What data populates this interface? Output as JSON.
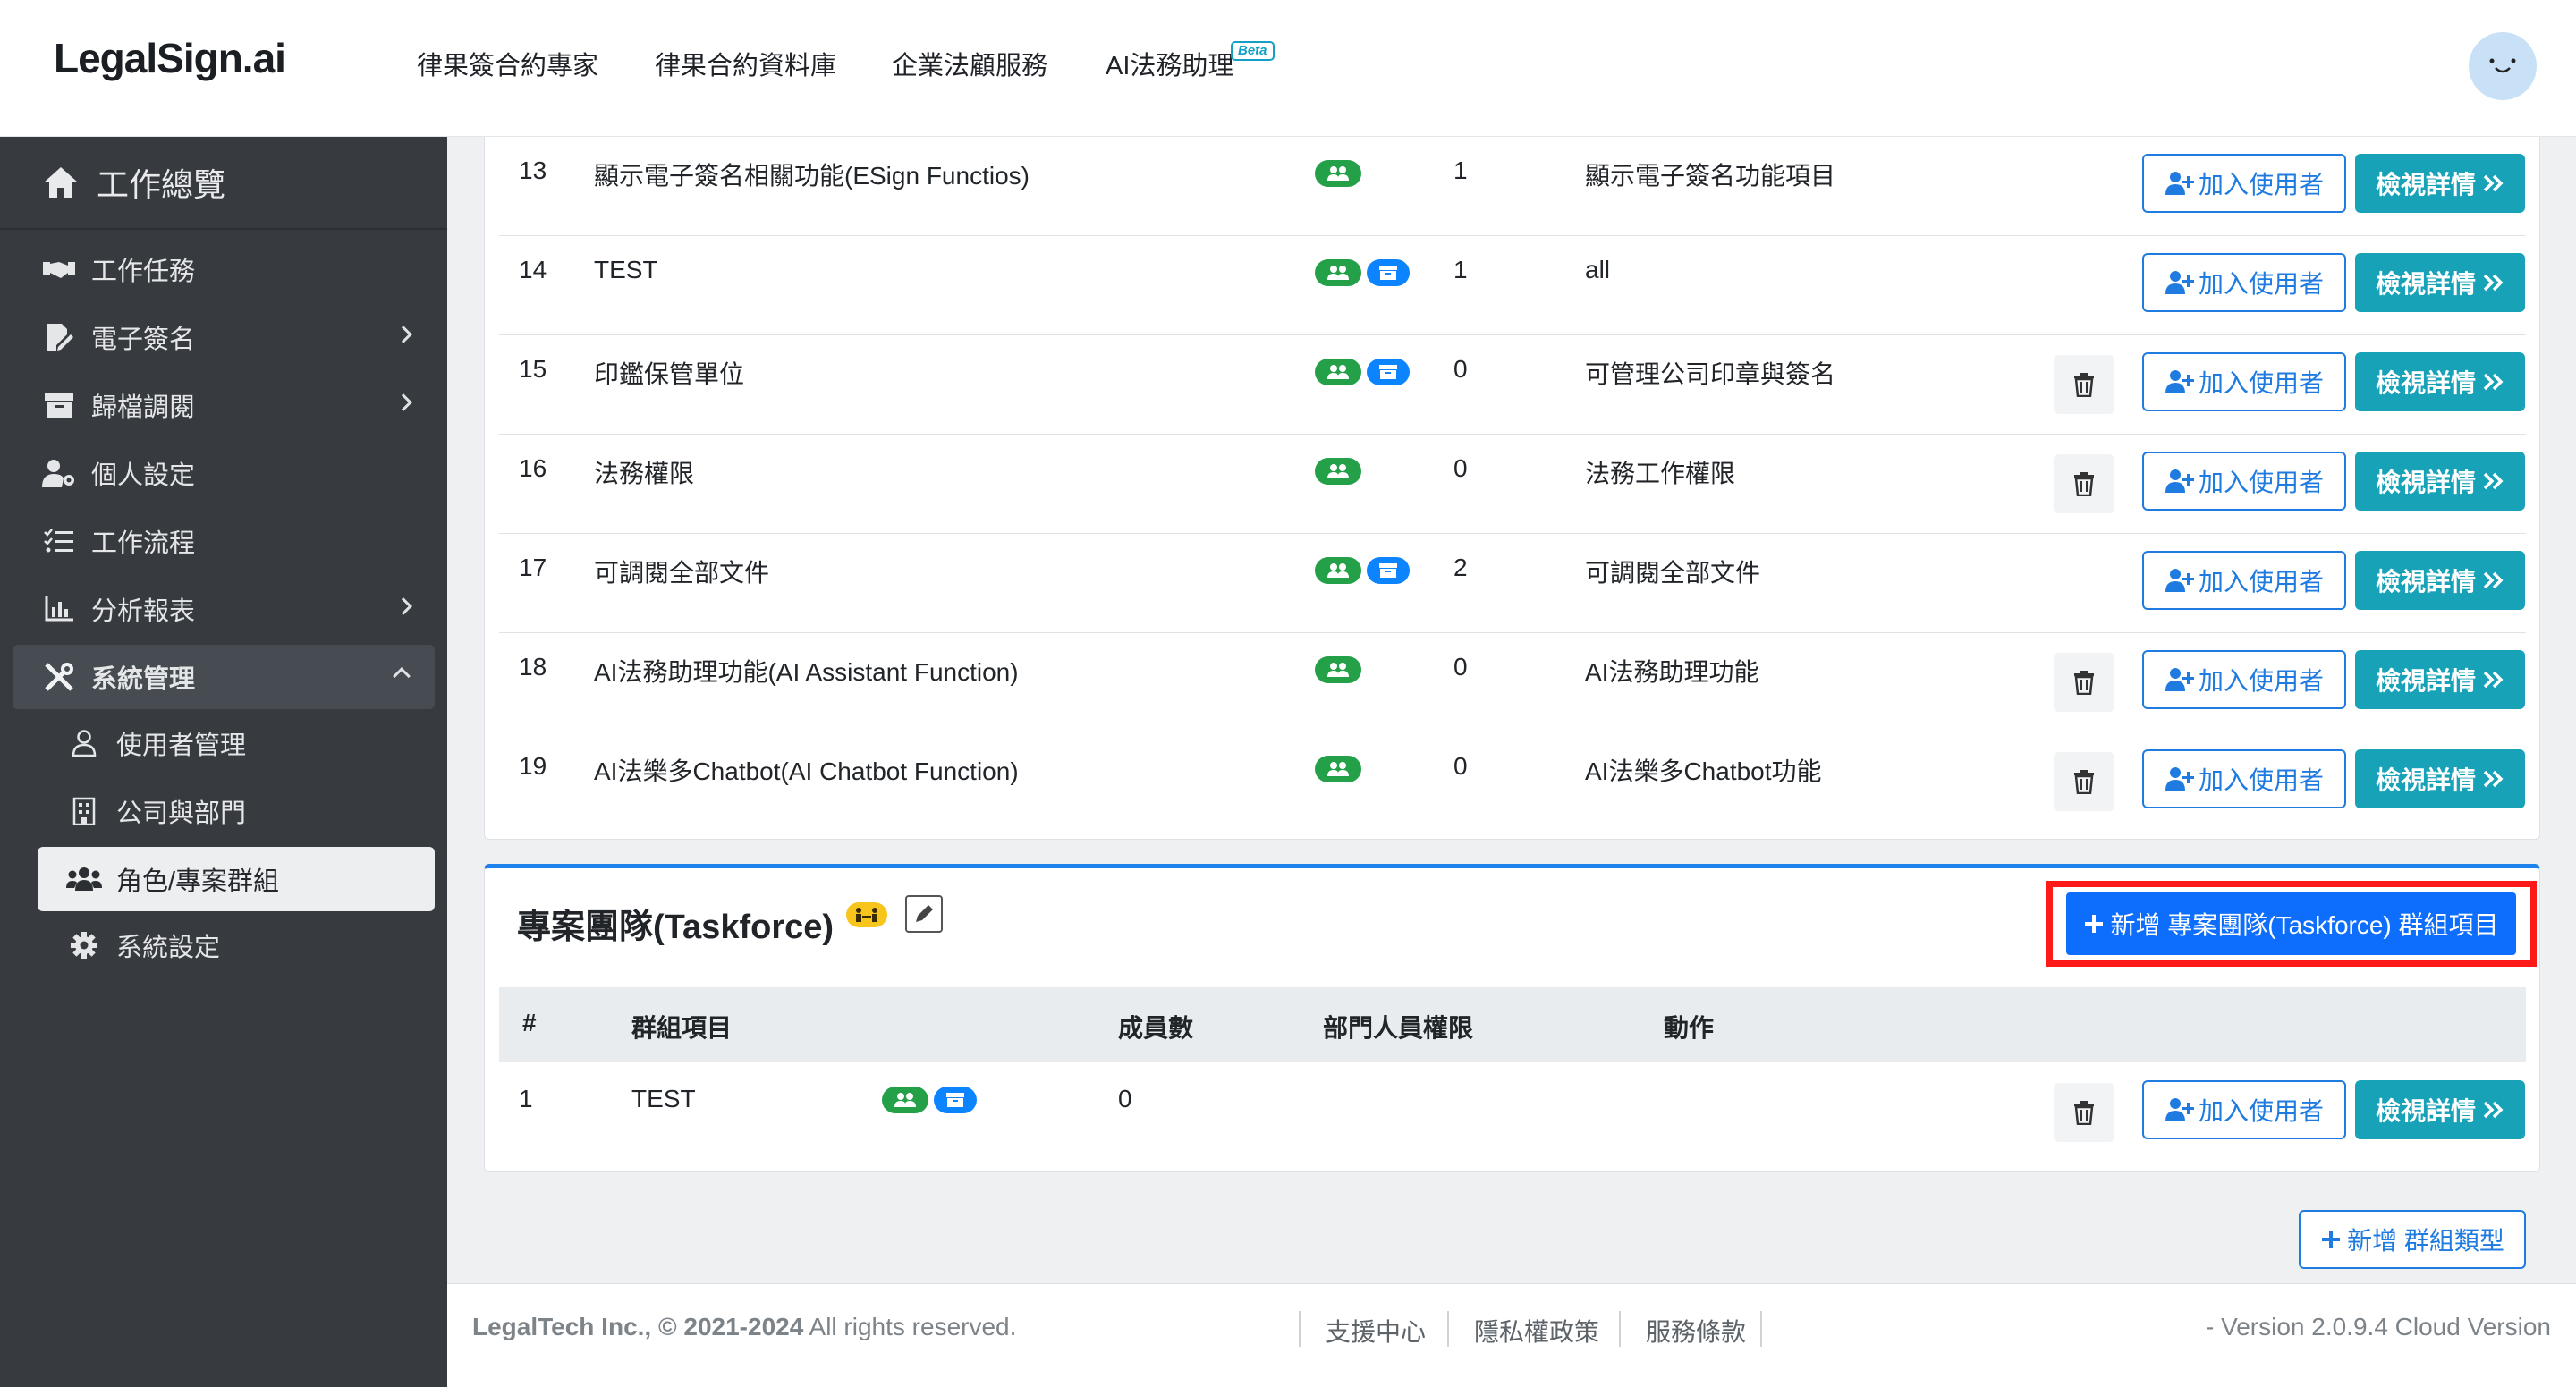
{
  "brand": {
    "logo": "LegalSign.ai"
  },
  "topnav": {
    "links": [
      "律果簽合約專家",
      "律果合約資料庫",
      "企業法顧服務",
      "AI法務助理"
    ],
    "beta": "Beta"
  },
  "sidebar": {
    "home": "工作總覽",
    "items": [
      "工作任務",
      "電子簽名",
      "歸檔調閱",
      "個人設定",
      "工作流程",
      "分析報表",
      "系統管理"
    ],
    "sub_items": [
      "使用者管理",
      "公司與部門",
      "角色/專案群組",
      "系統設定"
    ]
  },
  "groups_table": {
    "rows": [
      {
        "num": "13",
        "name": "顯示電子簽名相關功能(ESign Functios)",
        "members": "1",
        "desc": "顯示電子簽名功能項目"
      },
      {
        "num": "14",
        "name": "TEST",
        "members": "1",
        "desc": "all"
      },
      {
        "num": "15",
        "name": "印鑑保管單位",
        "members": "0",
        "desc": "可管理公司印章與簽名"
      },
      {
        "num": "16",
        "name": "法務權限",
        "members": "0",
        "desc": "法務工作權限"
      },
      {
        "num": "17",
        "name": "可調閱全部文件",
        "members": "2",
        "desc": "可調閱全部文件"
      },
      {
        "num": "18",
        "name": "AI法務助理功能(AI Assistant Function)",
        "members": "0",
        "desc": "AI法務助理功能"
      },
      {
        "num": "19",
        "name": "AI法樂多Chatbot(AI Chatbot Function)",
        "members": "0",
        "desc": "AI法樂多Chatbot功能"
      }
    ],
    "add_user_label": "加入使用者",
    "view_label": "檢視詳情"
  },
  "taskforce": {
    "title": "專案團隊(Taskforce)",
    "new_button": "新增 專案團隊(Taskforce) 群組項目",
    "headers": [
      "#",
      "群組項目",
      "成員數",
      "部門人員權限",
      "動作"
    ],
    "row": {
      "num": "1",
      "name": "TEST",
      "members": "0"
    }
  },
  "new_type_button": "新增 群組類型",
  "footer": {
    "company": "LegalTech Inc.,",
    "years": "© 2021-2024",
    "rights": "All rights reserved.",
    "links": [
      "支援中心",
      "隱私權政策",
      "服務條款"
    ],
    "version": "- Version 2.0.9.4 Cloud Version"
  },
  "colors": {
    "sidebar": "#373b40",
    "teal": "#17a2b8",
    "primary": "#0d6efd",
    "highlight": "#ff1a1a"
  }
}
